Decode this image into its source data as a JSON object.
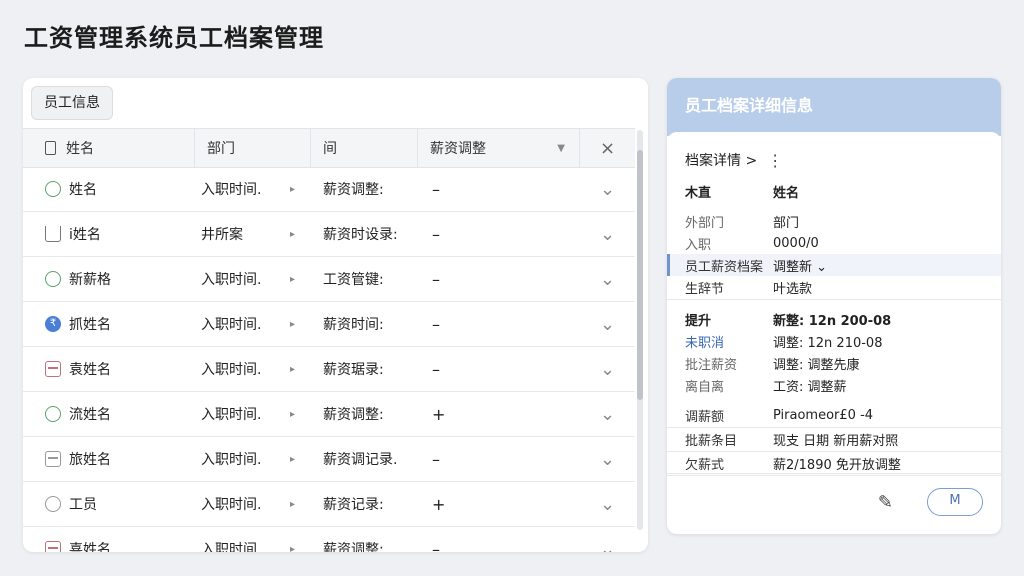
{
  "page": {
    "title": "工资管理系统员工档案管理"
  },
  "left": {
    "tab_label": "员工信息",
    "columns": [
      "姓名",
      "部门",
      "间",
      "薪资调整"
    ],
    "close_glyph": "×",
    "rows": [
      {
        "icon": "circle-green",
        "name": "姓名",
        "dept": "入职时间.",
        "record": "薪资调整:",
        "sign": "–"
      },
      {
        "icon": "flag",
        "name": "i姓名",
        "dept": "井所案",
        "record": "薪资时设录:",
        "sign": "–"
      },
      {
        "icon": "circle-green",
        "name": "新薪格",
        "dept": "入职时间.",
        "record": "工资管键:",
        "sign": "–"
      },
      {
        "icon": "blue-badge",
        "name": "抓姓名",
        "dept": "入职时间.",
        "record": "薪资时间:",
        "sign": "–"
      },
      {
        "icon": "card-red",
        "name": "袁姓名",
        "dept": "入职时间.",
        "record": "薪资琚录:",
        "sign": "–"
      },
      {
        "icon": "circle-green",
        "name": "流姓名",
        "dept": "入职时间.",
        "record": "薪资调整:",
        "sign": "+"
      },
      {
        "icon": "card-gray",
        "name": "旅姓名",
        "dept": "入职时间.",
        "record": "薪资调记录.",
        "sign": "–"
      },
      {
        "icon": "circle-gray",
        "name": "工员",
        "dept": "入职时间.",
        "record": "薪资记录:",
        "sign": "+"
      },
      {
        "icon": "card-red",
        "name": "喜姓名",
        "dept": "入职时间.",
        "record": "薪资调整:",
        "sign": "–"
      }
    ]
  },
  "right": {
    "header_title": "员工档案详细信息",
    "crumb": "档案详情 >",
    "kebab": "⋮",
    "items": [
      {
        "k": "木直",
        "v": "姓名",
        "style": "bold"
      },
      {
        "k": "",
        "v": "",
        "style": "gap"
      },
      {
        "k": "外部门",
        "v": "部门",
        "style": "muted"
      },
      {
        "k": "入职",
        "v": "0000/0",
        "style": "muted"
      },
      {
        "k": "员工薪资档案",
        "v": "调整新 ⌄",
        "style": "active"
      },
      {
        "k": "生辞节",
        "v": "叶选款",
        "style": "sep"
      },
      {
        "k": "",
        "v": "",
        "style": "gap"
      },
      {
        "k": "提升",
        "v": "新整: 12n 200-08",
        "style": "bold"
      },
      {
        "k": "未职消",
        "v": "调整: 12n 210-08",
        "style": "blue"
      },
      {
        "k": "批注薪资",
        "v": "调整: 调整先康",
        "style": "muted"
      },
      {
        "k": "离自离",
        "v": "工资: 调整薪",
        "style": "muted"
      },
      {
        "k": "",
        "v": "",
        "style": "gap"
      },
      {
        "k": "调薪额",
        "v": "Piraomeor£0 -4",
        "style": "sep"
      },
      {
        "k": "批薪条目",
        "v": "现支 日期 新用薪对照",
        "style": "sep"
      },
      {
        "k": "欠薪式",
        "v": "薪2/1890 免开放调整",
        "style": "sep"
      }
    ],
    "edit_glyph": "✎",
    "button_label": "M"
  }
}
